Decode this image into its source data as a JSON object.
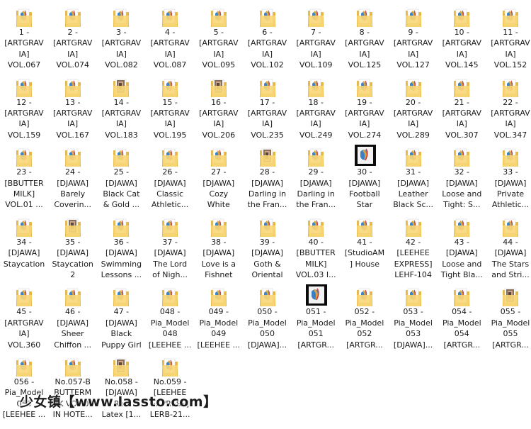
{
  "items": [
    {
      "lines": [
        "1 -",
        "[ARTGRAV",
        "IA]",
        "VOL.067"
      ],
      "icon": "folder-icon"
    },
    {
      "lines": [
        "2 -",
        "[ARTGRAV",
        "IA]",
        "VOL.074"
      ],
      "icon": "folder-icon"
    },
    {
      "lines": [
        "3 -",
        "[ARTGRAV",
        "IA]",
        "VOL.082"
      ],
      "icon": "folder-icon"
    },
    {
      "lines": [
        "4 -",
        "[ARTGRAV",
        "IA]",
        "VOL.087"
      ],
      "icon": "folder-icon"
    },
    {
      "lines": [
        "5 -",
        "[ARTGRAV",
        "IA]",
        "VOL.095"
      ],
      "icon": "folder-icon"
    },
    {
      "lines": [
        "6 -",
        "[ARTGRAV",
        "IA]",
        "VOL.102"
      ],
      "icon": "folder-icon"
    },
    {
      "lines": [
        "7 -",
        "[ARTGRAV",
        "IA]",
        "VOL.109"
      ],
      "icon": "folder-icon"
    },
    {
      "lines": [
        "8 -",
        "[ARTGRAV",
        "IA]",
        "VOL.125"
      ],
      "icon": "folder-icon"
    },
    {
      "lines": [
        "9 -",
        "[ARTGRAV",
        "IA]",
        "VOL.127"
      ],
      "icon": "folder-icon"
    },
    {
      "lines": [
        "10 -",
        "[ARTGRAV",
        "IA]",
        "VOL.145"
      ],
      "icon": "folder-icon"
    },
    {
      "lines": [
        "11 -",
        "[ARTGRAV",
        "IA]",
        "VOL.152"
      ],
      "icon": "folder-icon"
    },
    {
      "lines": [
        "12 -",
        "[ARTGRAV",
        "IA]",
        "VOL.159"
      ],
      "icon": "folder-icon"
    },
    {
      "lines": [
        "13 -",
        "[ARTGRAV",
        "IA]",
        "VOL.167"
      ],
      "icon": "folder-icon"
    },
    {
      "lines": [
        "14 -",
        "[ARTGRAV",
        "IA]",
        "VOL.183"
      ],
      "icon": "photo-folder-icon"
    },
    {
      "lines": [
        "15 -",
        "[ARTGRAV",
        "IA]",
        "VOL.195"
      ],
      "icon": "folder-icon"
    },
    {
      "lines": [
        "16 -",
        "[ARTGRAV",
        "IA]",
        "VOL.206"
      ],
      "icon": "photo-folder-icon"
    },
    {
      "lines": [
        "17 -",
        "[ARTGRAV",
        "IA]",
        "VOL.235"
      ],
      "icon": "folder-icon"
    },
    {
      "lines": [
        "18 -",
        "[ARTGRAV",
        "IA]",
        "VOL.249"
      ],
      "icon": "folder-icon"
    },
    {
      "lines": [
        "19 -",
        "[ARTGRAV",
        "IA]",
        "VOL.274"
      ],
      "icon": "folder-icon"
    },
    {
      "lines": [
        "20 -",
        "[ARTGRAV",
        "IA]",
        "VOL.289"
      ],
      "icon": "folder-icon"
    },
    {
      "lines": [
        "21 -",
        "[ARTGRAV",
        "IA]",
        "VOL.307"
      ],
      "icon": "folder-icon"
    },
    {
      "lines": [
        "22 -",
        "[ARTGRAV",
        "IA]",
        "VOL.347"
      ],
      "icon": "folder-icon"
    },
    {
      "lines": [
        "23 -",
        "[BBUTTER",
        "MILK]",
        "VOL.01 ..."
      ],
      "icon": "folder-icon"
    },
    {
      "lines": [
        "24 -",
        "[DJAWA]",
        "Barely",
        "Coverin..."
      ],
      "icon": "folder-icon"
    },
    {
      "lines": [
        "25 -",
        "[DJAWA]",
        "Black Cat",
        "& Gold ..."
      ],
      "icon": "folder-icon"
    },
    {
      "lines": [
        "26 -",
        "[DJAWA]",
        "Classic",
        "Athletic..."
      ],
      "icon": "folder-icon"
    },
    {
      "lines": [
        "27 -",
        "[DJAWA]",
        "Cozy",
        "White"
      ],
      "icon": "folder-icon"
    },
    {
      "lines": [
        "28 -",
        "[DJAWA]",
        "Darling in",
        "the Fran..."
      ],
      "icon": "photo-folder-icon"
    },
    {
      "lines": [
        "29 -",
        "[DJAWA]",
        "Darling in",
        "the Fran..."
      ],
      "icon": "folder-icon"
    },
    {
      "lines": [
        "30 -",
        "[DJAWA]",
        "Football",
        "Star"
      ],
      "icon": "dark-folder-icon"
    },
    {
      "lines": [
        "31 -",
        "[DJAWA]",
        "Leather",
        "Black Sc..."
      ],
      "icon": "folder-icon"
    },
    {
      "lines": [
        "32 -",
        "[DJAWA]",
        "Loose and",
        "Tight: S..."
      ],
      "icon": "folder-icon"
    },
    {
      "lines": [
        "33 -",
        "[DJAWA]",
        "Private",
        "Athletic..."
      ],
      "icon": "folder-icon"
    },
    {
      "lines": [
        "34 -",
        "[DJAWA]",
        "Staycation"
      ],
      "icon": "folder-icon"
    },
    {
      "lines": [
        "35 -",
        "[DJAWA]",
        "Staycation",
        "2"
      ],
      "icon": "photo-folder-icon"
    },
    {
      "lines": [
        "36 -",
        "[DJAWA]",
        "Swimming",
        "Lessons ..."
      ],
      "icon": "folder-icon"
    },
    {
      "lines": [
        "37 -",
        "[DJAWA]",
        "The Lord",
        "of Nigh..."
      ],
      "icon": "folder-icon"
    },
    {
      "lines": [
        "38 -",
        "[DJAWA]",
        "Love is a",
        "Fishnet"
      ],
      "icon": "folder-icon"
    },
    {
      "lines": [
        "39 -",
        "[DJAWA]",
        "Goth &",
        "Oriental"
      ],
      "icon": "folder-icon"
    },
    {
      "lines": [
        "40 -",
        "[BBUTTER",
        "MILK]",
        "VOL.03 I..."
      ],
      "icon": "folder-icon"
    },
    {
      "lines": [
        "41 -",
        "[StudioAM",
        "] House"
      ],
      "icon": "folder-icon"
    },
    {
      "lines": [
        "42 -",
        "[LEEHEE",
        "EXPRESS]",
        "LEHF-104"
      ],
      "icon": "folder-icon"
    },
    {
      "lines": [
        "43 -",
        "[DJAWA]",
        "Loose and",
        "Tight Bla..."
      ],
      "icon": "folder-icon"
    },
    {
      "lines": [
        "44 -",
        "[DJAWA]",
        "The Stars",
        "and Stri..."
      ],
      "icon": "folder-icon"
    },
    {
      "lines": [
        "45 -",
        "[ARTGRAV",
        "IA]",
        "VOL.360"
      ],
      "icon": "folder-icon"
    },
    {
      "lines": [
        "46 -",
        "[DJAWA]",
        "Sheer",
        "Chiffon ..."
      ],
      "icon": "folder-icon"
    },
    {
      "lines": [
        "47 -",
        "[DJAWA]",
        "Black",
        "Puppy Girl"
      ],
      "icon": "folder-icon"
    },
    {
      "lines": [
        "048 -",
        "Pia_Model",
        "048",
        "[LEEHEE ..."
      ],
      "icon": "folder-icon"
    },
    {
      "lines": [
        "049 -",
        "Pia_Model",
        "049",
        "[LEEHEE ..."
      ],
      "icon": "folder-icon"
    },
    {
      "lines": [
        "050 -",
        "Pia_Model",
        "050",
        "[DJAWA]..."
      ],
      "icon": "folder-icon"
    },
    {
      "lines": [
        "051 -",
        "Pia_Model",
        "051",
        "[ARTGR..."
      ],
      "icon": "dark-folder-icon"
    },
    {
      "lines": [
        "052 -",
        "Pia_Model",
        "052",
        "[ARTGR..."
      ],
      "icon": "folder-icon"
    },
    {
      "lines": [
        "053 -",
        "Pia_Model",
        "053",
        "[DJAWA]..."
      ],
      "icon": "folder-icon"
    },
    {
      "lines": [
        "054 -",
        "Pia_Model",
        "054",
        "[ARTGR..."
      ],
      "icon": "folder-icon"
    },
    {
      "lines": [
        "055 -",
        "Pia_Model",
        "055",
        "[ARTGR..."
      ],
      "icon": "photo-folder-icon"
    },
    {
      "lines": [
        "056 -",
        "Pia_Model",
        "056",
        "[LEEHEE ..."
      ],
      "icon": "folder-icon"
    },
    {
      "lines": [
        "No.057-B",
        "BUTTERM",
        "ILK VOL.03",
        "IN HOTE..."
      ],
      "icon": "folder-icon"
    },
    {
      "lines": [
        "No.058 -",
        "[DJAWA]",
        "Red",
        "Latex [1..."
      ],
      "icon": "photo-folder-icon"
    },
    {
      "lines": [
        "No.059 -",
        "[LEEHEE",
        "EXPRESS]",
        "LERB-21..."
      ],
      "icon": "folder-icon"
    }
  ],
  "watermark": "少女镇【www.lassto.com】",
  "colors": {
    "folder_back": "#e6b84a",
    "folder_front": "#f7d777",
    "paper": "#ffffff",
    "text": "#1a1a1a"
  }
}
